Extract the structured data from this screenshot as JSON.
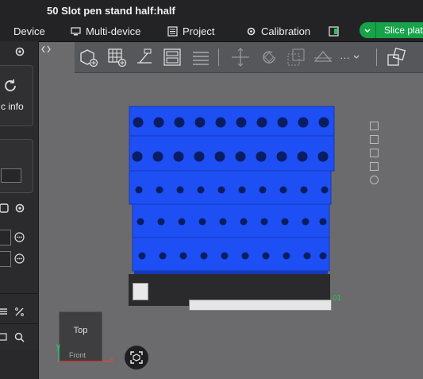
{
  "window": {
    "title": "50 Slot pen stand half:half"
  },
  "menu": [
    {
      "label": "Device",
      "icon": "monitor-icon"
    },
    {
      "label": "Multi-device",
      "icon": "multi-device-icon"
    },
    {
      "label": "Project",
      "icon": "project-icon"
    },
    {
      "label": "Calibration",
      "icon": "calibration-gear-icon"
    }
  ],
  "slice_button": {
    "label": "Slice plat"
  },
  "left_panel": {
    "info_label": "c info"
  },
  "viewport": {
    "axis_cube": {
      "top_label": "Top",
      "front_label": "Front"
    },
    "plate_label": "01",
    "axis_x": "x",
    "axis_y": "y",
    "toolbar_more": "···"
  },
  "colors": {
    "accent": "#16a34a",
    "model": "#1d4ff5",
    "viewport_bg": "#6b6b6d"
  }
}
